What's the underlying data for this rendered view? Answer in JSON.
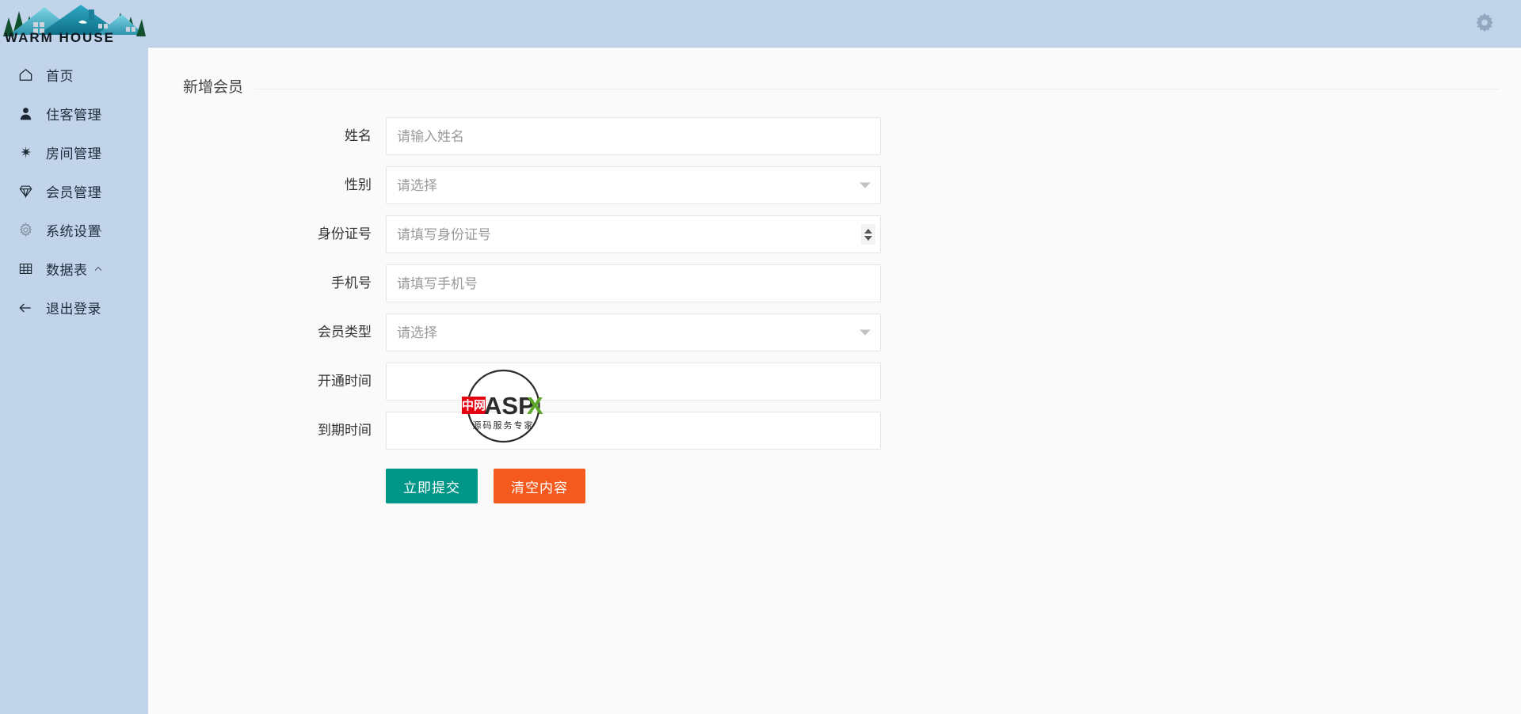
{
  "brand": {
    "name": "WARM HOUSE",
    "logo_icon": "house-mountain-logo"
  },
  "sidebar": {
    "items": [
      {
        "label": "首页",
        "icon": "home-icon",
        "chevron": false
      },
      {
        "label": "住客管理",
        "icon": "user-icon",
        "chevron": true
      },
      {
        "label": "房间管理",
        "icon": "key-icon",
        "chevron": true
      },
      {
        "label": "会员管理",
        "icon": "diamond-icon",
        "chevron": true
      },
      {
        "label": "系统设置",
        "icon": "gear-icon",
        "chevron": true
      },
      {
        "label": "数据表",
        "icon": "table-icon",
        "chevron": true
      },
      {
        "label": "退出登录",
        "icon": "arrow-left-icon",
        "chevron": false
      }
    ]
  },
  "header": {
    "settings_icon": "gear-icon"
  },
  "main": {
    "section_title": "新增会员",
    "fields": [
      {
        "label": "姓名",
        "value": "",
        "placeholder": "请输入姓名",
        "control": "text"
      },
      {
        "label": "性别",
        "value": "",
        "placeholder": "请选择",
        "control": "select"
      },
      {
        "label": "身份证号",
        "value": "",
        "placeholder": "请填写身份证号",
        "control": "number"
      },
      {
        "label": "手机号",
        "value": "",
        "placeholder": "请填写手机号",
        "control": "text"
      },
      {
        "label": "会员类型",
        "value": "",
        "placeholder": "请选择",
        "control": "select"
      },
      {
        "label": "开通时间",
        "value": "",
        "placeholder": "",
        "control": "date"
      },
      {
        "label": "到期时间",
        "value": "",
        "placeholder": "",
        "control": "date"
      }
    ],
    "buttons": {
      "submit_label": "立即提交",
      "reset_label": "清空内容"
    }
  },
  "watermark": {
    "badge_text": "中网",
    "title": "ASPX",
    "subtitle": "源码服务专家"
  },
  "colors": {
    "sidebar_bg": "#c2d4ea",
    "header_bg": "#c2d4ea",
    "content_bg": "#fafafa",
    "primary_button": "#009688",
    "danger_button": "#f4591e",
    "watermark_red": "#e60012",
    "watermark_green": "#5ba829"
  }
}
